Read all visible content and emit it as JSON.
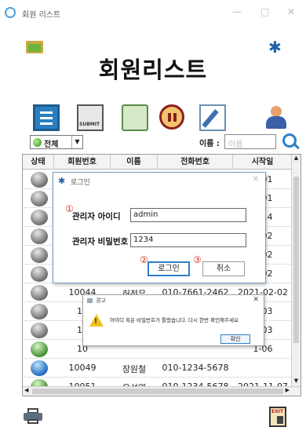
{
  "window": {
    "title": "회원 리스트",
    "minimize": "—",
    "maximize": "□",
    "close": "✕"
  },
  "header": {
    "title": "회원리스트"
  },
  "toolbar": {
    "submit_text": "SUBMIT"
  },
  "filter": {
    "selected": "전체",
    "name_label": "이름 :",
    "name_placeholder": "이름"
  },
  "table": {
    "columns": [
      "상태",
      "회원번호",
      "이름",
      "전화번호",
      "시작일"
    ],
    "rows": [
      {
        "status": "gray",
        "id": "",
        "name": "",
        "phone": "",
        "date": "1-01"
      },
      {
        "status": "gray",
        "id": "",
        "name": "",
        "phone": "",
        "date": "1-01"
      },
      {
        "status": "gray",
        "id": "",
        "name": "",
        "phone": "",
        "date": "1-14"
      },
      {
        "status": "gray",
        "id": "",
        "name": "",
        "phone": "",
        "date": "2-02"
      },
      {
        "status": "gray",
        "id": "",
        "name": "",
        "phone": "",
        "date": "2-02"
      },
      {
        "status": "gray",
        "id": "",
        "name": "",
        "phone": "",
        "date": "2-02"
      },
      {
        "status": "gray",
        "id": "10044",
        "name": "허정무",
        "phone": "010-7661-2462",
        "date": "2021-02-02"
      },
      {
        "status": "gray",
        "id": "10",
        "name": "",
        "phone": "",
        "date": "2-03"
      },
      {
        "status": "gray",
        "id": "10",
        "name": "",
        "phone": "",
        "date": "2-03"
      },
      {
        "status": "green",
        "id": "10",
        "name": "",
        "phone": "",
        "date": "1-06"
      },
      {
        "status": "blue",
        "id": "10049",
        "name": "장원철",
        "phone": "010-1234-5678",
        "date": ""
      },
      {
        "status": "green",
        "id": "10051",
        "name": "윤석열",
        "phone": "010-1234-5678",
        "date": "2021-11-07"
      }
    ]
  },
  "login": {
    "title": "로그인",
    "close": "✕",
    "id_label": "관리자 아이디",
    "id_value": "admin",
    "pw_label": "관리자 비밀번호",
    "pw_value": "1234",
    "login_button": "로그인",
    "cancel_button": "취소",
    "markers": [
      "①",
      "②",
      "③"
    ]
  },
  "alert": {
    "title": "경고",
    "close": "✕",
    "message": "아이디 혹은 비밀번호가 틀렸습니다. 다시 한번 확인해주세요",
    "ok_button": "확인"
  },
  "exit_icon_text": "EXIT",
  "colors": {
    "accent": "#2e7fc9",
    "marker": "#d63a2a",
    "warning": "#f2c21b"
  }
}
